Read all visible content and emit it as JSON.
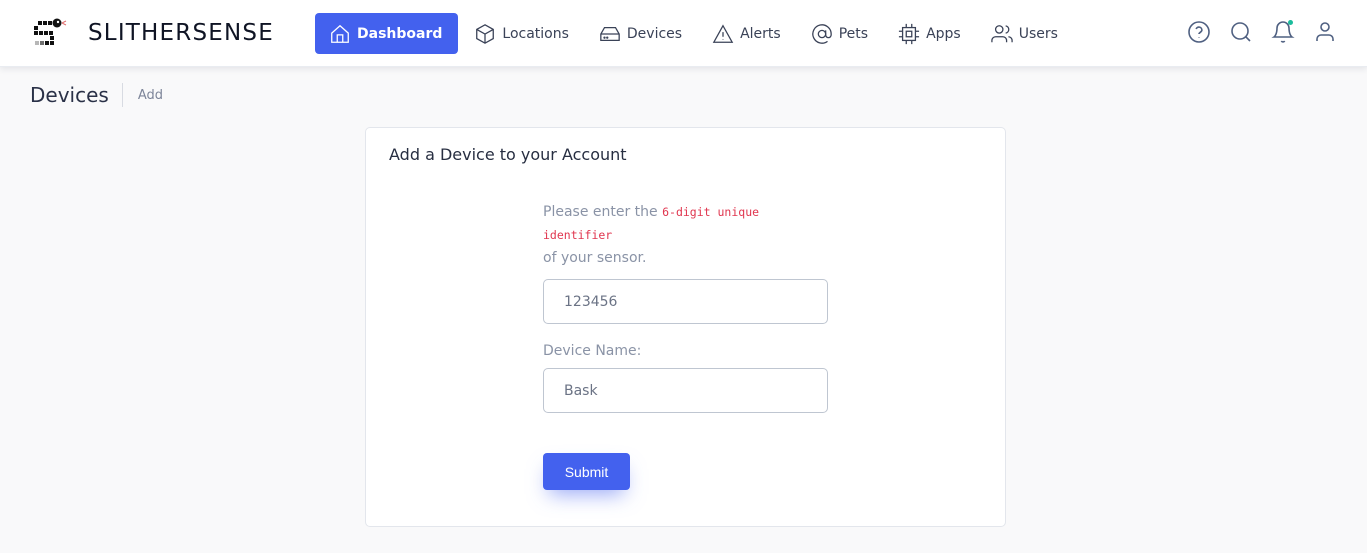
{
  "brand": {
    "name": "SLITHERSENSE",
    "logo_icon": "snake-s-logo"
  },
  "nav": {
    "items": [
      {
        "label": "Dashboard",
        "icon": "home-icon",
        "active": true
      },
      {
        "label": "Locations",
        "icon": "cube-icon",
        "active": false
      },
      {
        "label": "Devices",
        "icon": "hard-drive-icon",
        "active": false
      },
      {
        "label": "Alerts",
        "icon": "warning-triangle-icon",
        "active": false
      },
      {
        "label": "Pets",
        "icon": "at-sign-icon",
        "active": false
      },
      {
        "label": "Apps",
        "icon": "cpu-chip-icon",
        "active": false
      },
      {
        "label": "Users",
        "icon": "users-icon",
        "active": false
      }
    ],
    "accent_color": "#4361ee"
  },
  "tools": {
    "help": "help-circle-icon",
    "search": "search-icon",
    "notifications": "bell-icon",
    "notification_dot_color": "#1abc9c",
    "profile": "user-icon"
  },
  "breadcrumb": {
    "title": "Devices",
    "current": "Add"
  },
  "card": {
    "title": "Add a Device to your Account",
    "instruction_prefix": "Please enter the",
    "instruction_code": "6-digit unique identifier",
    "instruction_suffix": "of your sensor.",
    "identifier_value": "123456",
    "device_name_label": "Device Name:",
    "device_name_value": "Bask",
    "submit_label": "Submit"
  }
}
